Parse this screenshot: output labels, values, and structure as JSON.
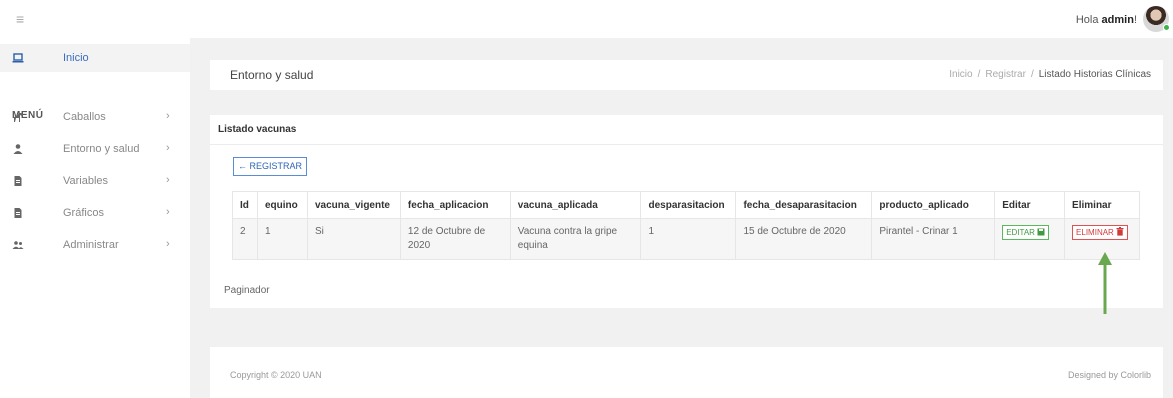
{
  "header": {
    "greeting": "Hola",
    "username": "admin",
    "greeting_suffix": "!"
  },
  "sidebar": {
    "home": {
      "label": "Inicio",
      "icon": "laptop-icon"
    },
    "menu_title": "MENÚ",
    "items": [
      {
        "label": "Caballos",
        "icon": "horse-icon"
      },
      {
        "label": "Entorno y salud",
        "icon": "user-icon"
      },
      {
        "label": "Variables",
        "icon": "document-icon"
      },
      {
        "label": "Gráficos",
        "icon": "document-icon"
      },
      {
        "label": "Administrar",
        "icon": "users-icon"
      }
    ]
  },
  "page": {
    "title": "Entorno y salud",
    "breadcrumb": [
      "Inicio",
      "Registrar",
      "Listado Historias Clínicas"
    ]
  },
  "card": {
    "title": "Listado vacunas",
    "register_button": "← REGISTRAR",
    "paginator": "Paginador"
  },
  "table": {
    "columns": [
      "Id",
      "equino",
      "vacuna_vigente",
      "fecha_aplicacion",
      "vacuna_aplicada",
      "desparasitacion",
      "fecha_desaparasitacion",
      "producto_aplicado",
      "Editar",
      "Eliminar"
    ],
    "rows": [
      {
        "id": "2",
        "equino": "1",
        "vacuna_vigente": "Si",
        "fecha_aplicacion": "12 de Octubre de 2020",
        "vacuna_aplicada": "Vacuna contra la gripe equina",
        "desparasitacion": "1",
        "fecha_desaparasitacion": "15 de Octubre de 2020",
        "producto_aplicado": "Pirantel - Crinar 1",
        "edit_label": "EDITAR",
        "delete_label": "ELIMINAR"
      }
    ]
  },
  "footer": {
    "copyright": "Copyright © 2020 UAN",
    "designed_by": "Designed by Colorlib"
  },
  "colors": {
    "primary": "#2f64b8",
    "success": "#5cb85c",
    "danger": "#e05252",
    "annotation_arrow": "#6aa84f"
  }
}
